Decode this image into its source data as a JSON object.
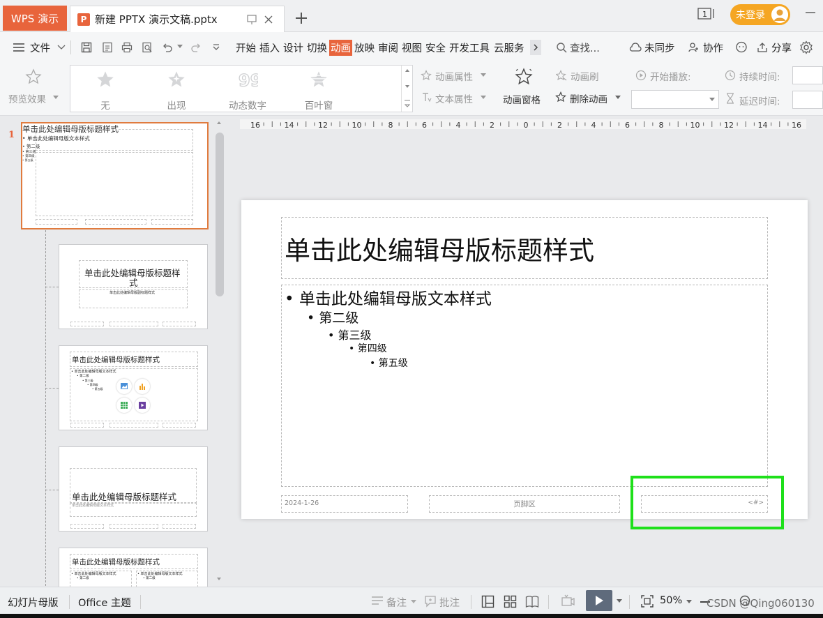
{
  "titlebar": {
    "app_tab": "WPS 演示",
    "doc_tab_title": "新建 PPTX 演示文稿.pptx",
    "doc_logo_letter": "P",
    "window_count": "1",
    "login_label": "未登录"
  },
  "menubar": {
    "file_label": "文件",
    "tabs": [
      "开始",
      "插入",
      "设计",
      "切换",
      "动画",
      "放映",
      "审阅",
      "视图",
      "安全",
      "开发工具",
      "云服务"
    ],
    "active_tab": "动画",
    "search_label": "查找...",
    "sync_label": "未同步",
    "collab_label": "协作",
    "share_label": "分享"
  },
  "ribbon": {
    "preview_label": "预览效果",
    "effects": [
      "无",
      "出现",
      "动态数字",
      "百叶窗"
    ],
    "anim_props_label": "动画属性",
    "text_props_label": "文本属性",
    "anim_pane_label": "动画窗格",
    "anim_brush_label": "动画刷",
    "delete_anim_label": "删除动画",
    "start_play_label": "开始播放:",
    "duration_label": "持续时间:",
    "delay_label": "延迟时间:"
  },
  "thumbnails": {
    "slide_number": "1",
    "master_title": "单击此处编辑母版标题样式",
    "master_text": "单击此处编辑母版文本样式",
    "level2": "第二级",
    "level3": "第三级",
    "level4": "第四级",
    "level5": "第五级",
    "layout2_title_a": "单击此处编辑母版标题样",
    "layout2_title_b": "式",
    "layout2_sub": "单击此处编辑母版副标题样式",
    "layout3_title": "单击此处编辑母版标题样式",
    "layout4_title": "单击此处编辑母版标题样式",
    "layout4_sub": "单击此处编辑母版文本样式",
    "layout5_title": "单击此处编辑母版标题样式"
  },
  "ruler": {
    "labels": [
      "16",
      "14",
      "12",
      "10",
      "8",
      "6",
      "4",
      "2",
      "0",
      "2",
      "4",
      "6",
      "8",
      "10",
      "12",
      "14",
      "16"
    ]
  },
  "slide": {
    "title": "单击此处编辑母版标题样式",
    "bullets": [
      {
        "text": "单击此处编辑母版文本样式",
        "level": 1
      },
      {
        "text": "第二级",
        "level": 2
      },
      {
        "text": "第三级",
        "level": 3
      },
      {
        "text": "第四级",
        "level": 4
      },
      {
        "text": "第五级",
        "level": 5
      }
    ],
    "date": "2024-1-26",
    "footer": "页脚区",
    "page_number": "<#>"
  },
  "statusbar": {
    "view_label": "幻灯片母版",
    "theme_label": "Office 主题",
    "notes_label": "备注",
    "comment_label": "批注",
    "zoom": "50%",
    "watermark": "CSDN @Qing060130"
  },
  "colors": {
    "accent": "#e8643c",
    "login": "#f5a623",
    "highlight": "#1ee01a"
  }
}
